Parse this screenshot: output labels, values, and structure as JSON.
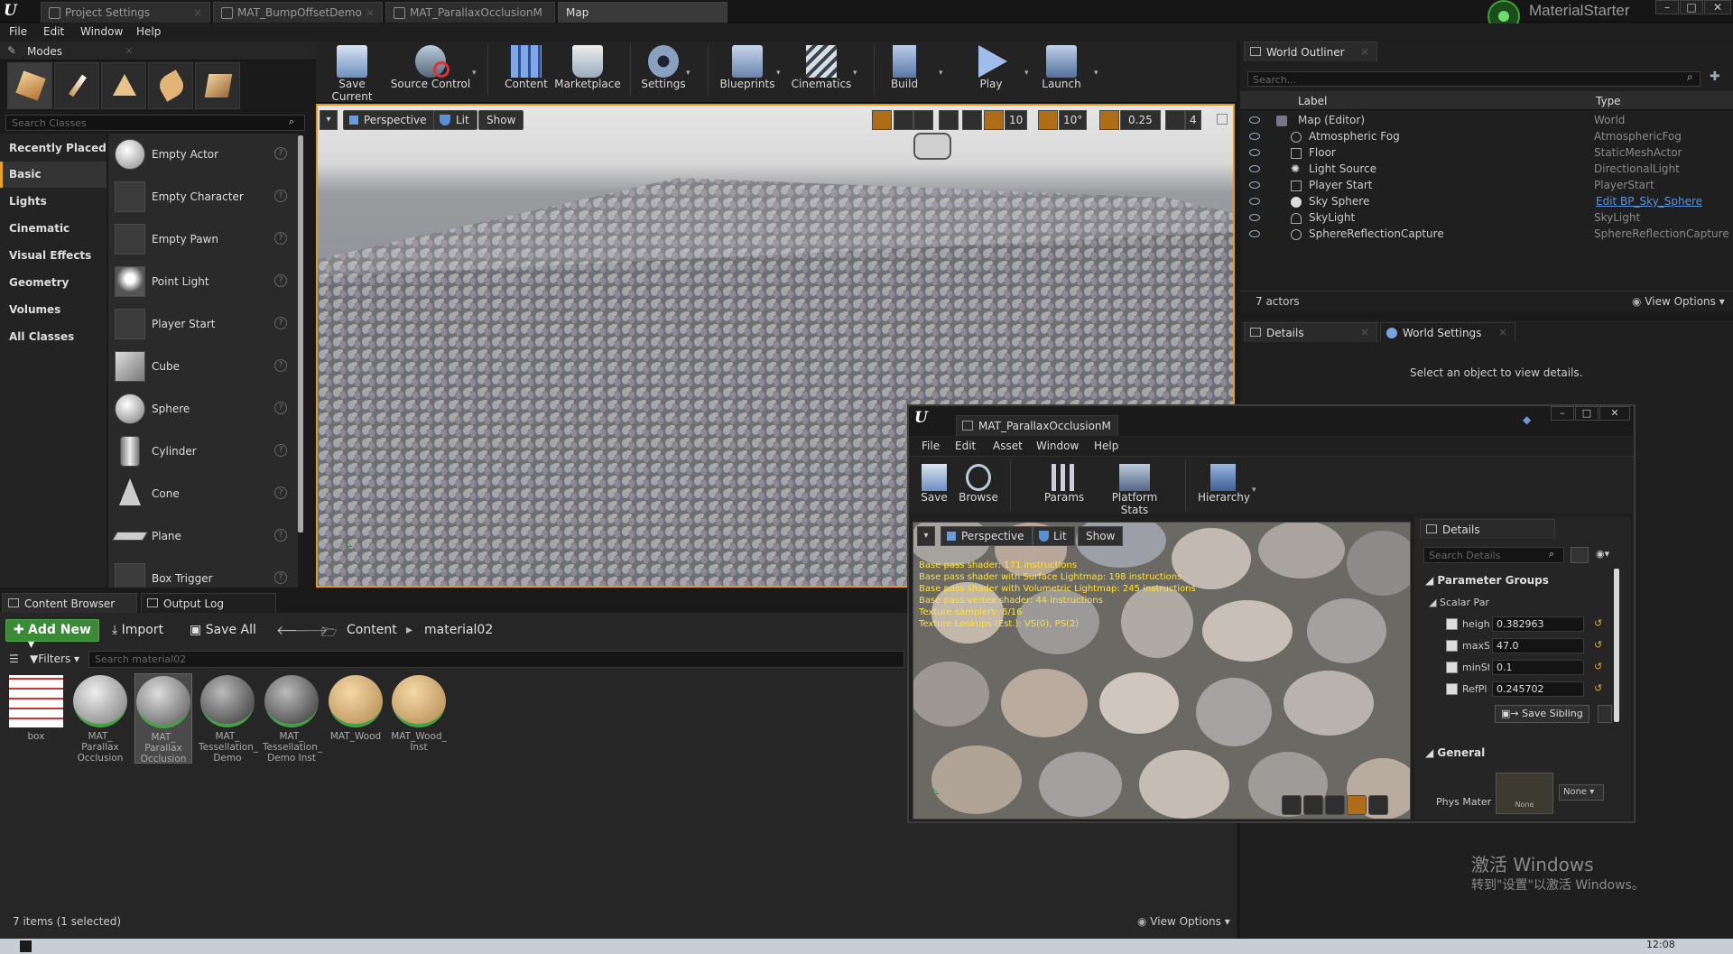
{
  "title_bar": {
    "tabs": [
      "Project Settings",
      "MAT_BumpOffsetDemo",
      "MAT_ParallaxOcclusionM",
      "Map"
    ],
    "project_name": "MaterialStarter"
  },
  "menu": [
    "File",
    "Edit",
    "Window",
    "Help"
  ],
  "modes": {
    "title": "Modes",
    "search_placeholder": "Search Classes",
    "categories": [
      "Recently Placed",
      "Basic",
      "Lights",
      "Cinematic",
      "Visual Effects",
      "Geometry",
      "Volumes",
      "All Classes"
    ],
    "active_category": "Basic",
    "items": [
      "Empty Actor",
      "Empty Character",
      "Empty Pawn",
      "Point Light",
      "Player Start",
      "Cube",
      "Sphere",
      "Cylinder",
      "Cone",
      "Plane",
      "Box Trigger"
    ]
  },
  "toolbar": {
    "buttons": [
      "Save Current",
      "Source Control",
      "Content",
      "Marketplace",
      "Settings",
      "Blueprints",
      "Cinematics",
      "Build",
      "Play",
      "Launch"
    ]
  },
  "viewport": {
    "perspective": "Perspective",
    "lit": "Lit",
    "show": "Show",
    "grid_snap": "10",
    "rotation_snap": "10°",
    "scale_snap": "0.25",
    "camera_speed": "4"
  },
  "outliner": {
    "title": "World Outliner",
    "search_placeholder": "Search...",
    "col_label": "Label",
    "col_type": "Type",
    "rows": [
      {
        "label": "Map (Editor)",
        "type": "World"
      },
      {
        "label": "Atmospheric Fog",
        "type": "AtmosphericFog"
      },
      {
        "label": "Floor",
        "type": "StaticMeshActor"
      },
      {
        "label": "Light Source",
        "type": "DirectionalLight"
      },
      {
        "label": "Player Start",
        "type": "PlayerStart"
      },
      {
        "label": "Sky Sphere",
        "type": "Edit BP_Sky_Sphere"
      },
      {
        "label": "SkyLight",
        "type": "SkyLight"
      },
      {
        "label": "SphereReflectionCapture",
        "type": "SphereReflectionCapture"
      }
    ],
    "actor_count": "7 actors",
    "view_options": "View Options"
  },
  "details": {
    "tab_details": "Details",
    "tab_world_settings": "World Settings",
    "empty_message": "Select an object to view details."
  },
  "content_browser": {
    "tab": "Content Browser",
    "tab_output": "Output Log",
    "add_new": "Add New",
    "import": "Import",
    "save_all": "Save All",
    "path_root": "Content",
    "path_folder": "material02",
    "filters": "Filters",
    "search_placeholder": "Search material02",
    "assets": [
      {
        "name": "box"
      },
      {
        "name": "MAT_ Parallax Occlusion"
      },
      {
        "name": "MAT_ Parallax Occlusion"
      },
      {
        "name": "MAT_ Tessellation_ Demo"
      },
      {
        "name": "MAT_ Tessellation_ Demo Inst"
      },
      {
        "name": "MAT_Wood"
      },
      {
        "name": "MAT_Wood_ Inst"
      }
    ],
    "status": "7 items (1 selected)",
    "view_options": "View Options"
  },
  "material_editor": {
    "tab_title": "MAT_ParallaxOcclusionM",
    "menu": [
      "File",
      "Edit",
      "Asset",
      "Window",
      "Help"
    ],
    "toolbar": [
      "Save",
      "Browse",
      "Params",
      "Platform Stats",
      "Hierarchy"
    ],
    "viewport": {
      "perspective": "Perspective",
      "lit": "Lit",
      "show": "Show"
    },
    "stats": [
      "Base pass shader: 171 instructions",
      "Base pass shader with Surface Lightmap: 198 instructions",
      "Base pass shader with Volumetric Lightmap: 245 instructions",
      "Base pass vertex shader: 44 instructions",
      "Texture samplers: 6/16",
      "Texture Lookups (Est.): VS(0), PS(2)"
    ],
    "details": {
      "title": "Details",
      "search_placeholder": "Search Details",
      "group": "Parameter Groups",
      "subgroup": "Scalar Par",
      "params": [
        {
          "label": "height",
          "value": "0.382963"
        },
        {
          "label": "maxS",
          "value": "47.0"
        },
        {
          "label": "minSt",
          "value": "0.1"
        },
        {
          "label": "RefPl",
          "value": "0.245702"
        }
      ],
      "save_sibling": "Save Sibling",
      "general": "General",
      "phys_mat_label": "Phys Mater",
      "phys_mat_thumb": "None",
      "phys_mat_value": "None"
    }
  },
  "os": {
    "activate_title": "激活 Windows",
    "activate_sub": "转到\"设置\"以激活 Windows。",
    "clock": "12:08"
  }
}
